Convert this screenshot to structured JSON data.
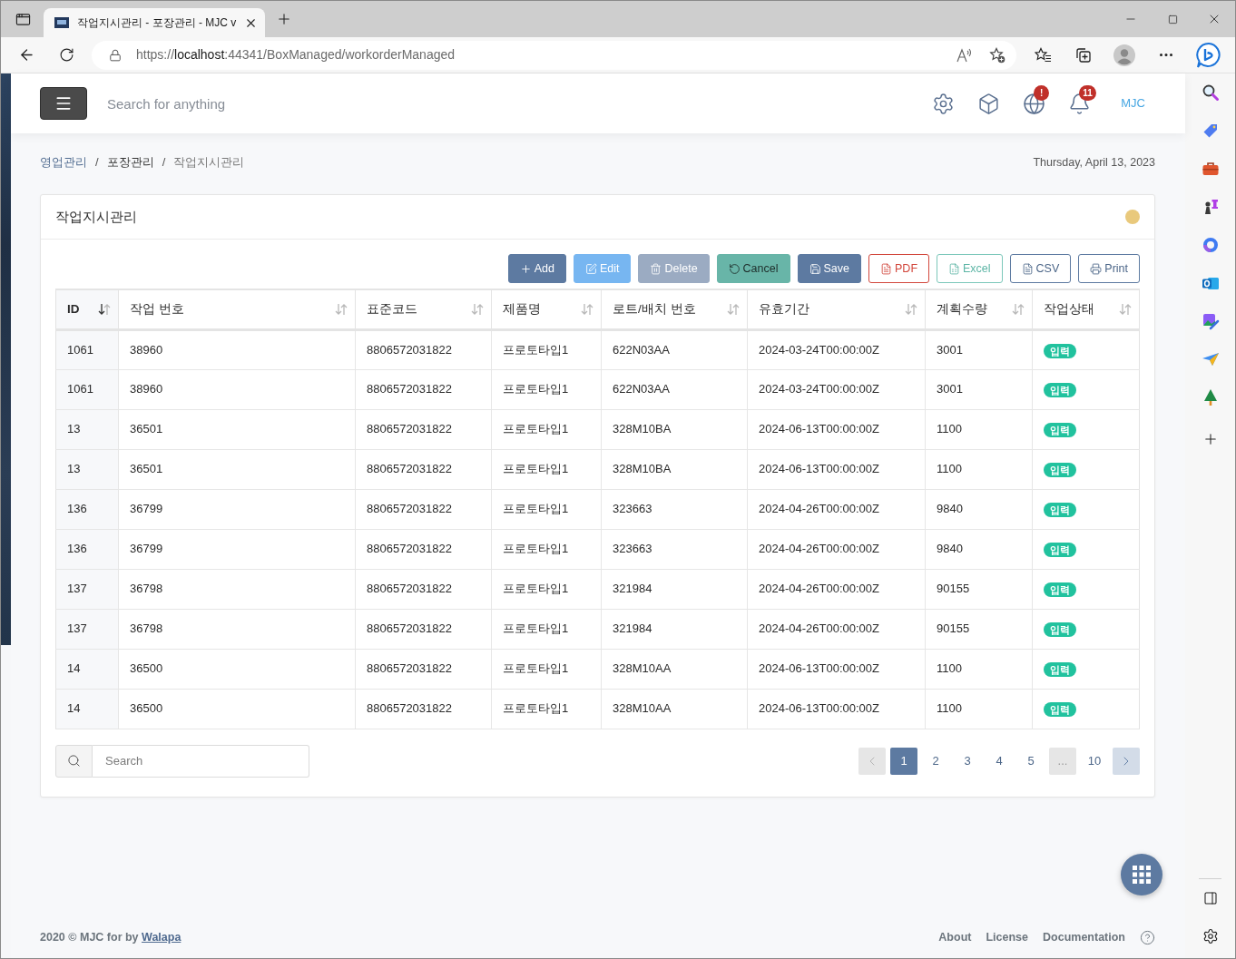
{
  "browser": {
    "tabs": [
      {
        "title": "작업지시관리 - 포장관리 - MJC v",
        "selected": true
      }
    ],
    "url": {
      "scheme": "https://",
      "host": "localhost",
      "path": ":44341/BoxManaged/workorderManaged"
    }
  },
  "header": {
    "search": {
      "placeholder": "Search for anything"
    },
    "actions": [
      {
        "kind": "gear"
      },
      {
        "kind": "cube"
      },
      {
        "kind": "globe",
        "badge": "!"
      },
      {
        "kind": "bell",
        "badge": "11"
      }
    ],
    "user": "MJC"
  },
  "breadcrumb": {
    "items": [
      {
        "label": "영업관리",
        "kind": "link"
      },
      {
        "label": "포장관리",
        "kind": "text"
      },
      {
        "label": "작업지시관리",
        "kind": "current"
      }
    ],
    "separators": [
      "/",
      "/"
    ]
  },
  "date": "Thursday, April 13, 2023",
  "card": {
    "title": "작업지시관리"
  },
  "toolbar": [
    {
      "label": "Add",
      "kind": "add"
    },
    {
      "label": "Edit",
      "kind": "edit"
    },
    {
      "label": "Delete",
      "kind": "delete"
    },
    {
      "label": "Cancel",
      "kind": "cancel"
    },
    {
      "label": "Save",
      "kind": "save"
    },
    {
      "label": "PDF",
      "kind": "pdf"
    },
    {
      "label": "Excel",
      "kind": "excel"
    },
    {
      "label": "CSV",
      "kind": "csv"
    },
    {
      "label": "Print",
      "kind": "print"
    }
  ],
  "table": {
    "columns": [
      {
        "label": "ID",
        "sorted": true
      },
      {
        "label": "작업 번호",
        "sorted": false
      },
      {
        "label": "표준코드",
        "sorted": false
      },
      {
        "label": "제품명",
        "sorted": false
      },
      {
        "label": "로트/배치 번호",
        "sorted": false
      },
      {
        "label": "유효기간",
        "sorted": false
      },
      {
        "label": "계획수량",
        "sorted": false
      },
      {
        "label": "작업상태",
        "sorted": false
      }
    ],
    "rows": [
      {
        "cells": [
          "1061",
          "38960",
          "8806572031822",
          "프로토타입1",
          "622N03AA",
          "2024-03-24T00:00:00Z",
          "3001"
        ],
        "status": "입력"
      },
      {
        "cells": [
          "1061",
          "38960",
          "8806572031822",
          "프로토타입1",
          "622N03AA",
          "2024-03-24T00:00:00Z",
          "3001"
        ],
        "status": "입력"
      },
      {
        "cells": [
          "13",
          "36501",
          "8806572031822",
          "프로토타입1",
          "328M10BA",
          "2024-06-13T00:00:00Z",
          "1100"
        ],
        "status": "입력"
      },
      {
        "cells": [
          "13",
          "36501",
          "8806572031822",
          "프로토타입1",
          "328M10BA",
          "2024-06-13T00:00:00Z",
          "1100"
        ],
        "status": "입력"
      },
      {
        "cells": [
          "136",
          "36799",
          "8806572031822",
          "프로토타입1",
          "323663",
          "2024-04-26T00:00:00Z",
          "9840"
        ],
        "status": "입력"
      },
      {
        "cells": [
          "136",
          "36799",
          "8806572031822",
          "프로토타입1",
          "323663",
          "2024-04-26T00:00:00Z",
          "9840"
        ],
        "status": "입력"
      },
      {
        "cells": [
          "137",
          "36798",
          "8806572031822",
          "프로토타입1",
          "321984",
          "2024-04-26T00:00:00Z",
          "90155"
        ],
        "status": "입력"
      },
      {
        "cells": [
          "137",
          "36798",
          "8806572031822",
          "프로토타입1",
          "321984",
          "2024-04-26T00:00:00Z",
          "90155"
        ],
        "status": "입력"
      },
      {
        "cells": [
          "14",
          "36500",
          "8806572031822",
          "프로토타입1",
          "328M10AA",
          "2024-06-13T00:00:00Z",
          "1100"
        ],
        "status": "입력"
      },
      {
        "cells": [
          "14",
          "36500",
          "8806572031822",
          "프로토타입1",
          "328M10AA",
          "2024-06-13T00:00:00Z",
          "1100"
        ],
        "status": "입력"
      }
    ]
  },
  "table_search": {
    "placeholder": "Search"
  },
  "pagination": {
    "prev": {
      "disabled": true
    },
    "pages": [
      {
        "label": "1",
        "kind": "page",
        "selected": true
      },
      {
        "label": "2",
        "kind": "page",
        "selected": false
      },
      {
        "label": "3",
        "kind": "page",
        "selected": false
      },
      {
        "label": "4",
        "kind": "page",
        "selected": false
      },
      {
        "label": "5",
        "kind": "page",
        "selected": false
      },
      {
        "label": "...",
        "kind": "ellipsis",
        "selected": false
      },
      {
        "label": "10",
        "kind": "page",
        "selected": false
      }
    ],
    "next": {
      "disabled": false
    }
  },
  "footer": {
    "copyright": "2020 © MJC for by",
    "credit_link": "Walapa",
    "links": [
      "About",
      "License",
      "Documentation"
    ]
  }
}
